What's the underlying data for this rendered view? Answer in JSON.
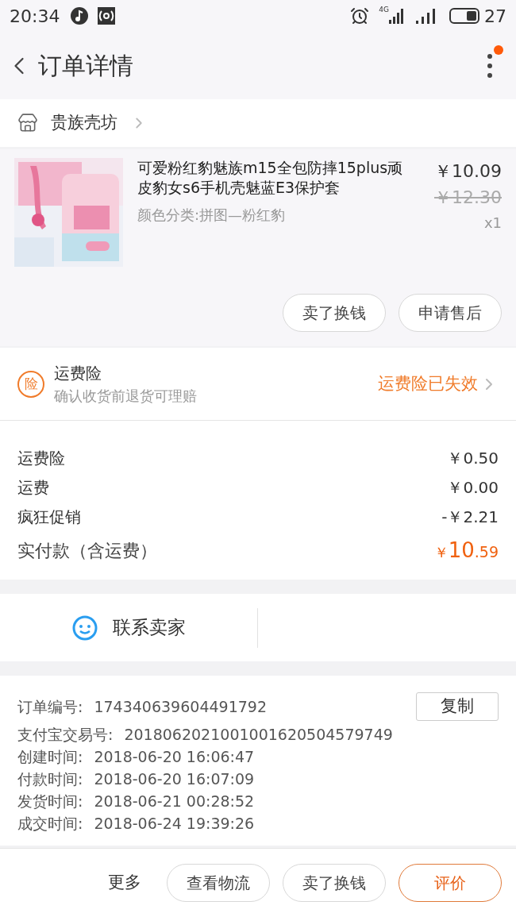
{
  "status_bar": {
    "time": "20:34",
    "network": "4G",
    "battery": "27"
  },
  "header": {
    "title": "订单详情",
    "notification_dot": true
  },
  "shop": {
    "name": "贵族壳坊"
  },
  "product": {
    "kind": "picture",
    "title": "可爱粉红豹魅族m15全包防摔15plus顽皮豹女s6手机壳魅蓝E3保护套",
    "variant": "颜色分类:拼图—粉红豹",
    "price": "￥10.09",
    "original_price": "￥12.30",
    "quantity": "x1",
    "actions": [
      "卖了换钱",
      "申请售后"
    ]
  },
  "insurance": {
    "title": "运费险",
    "subtitle": "确认收货前退货可理赔",
    "badge": "险",
    "status": "运费险已失效"
  },
  "fees": [
    {
      "label": "运费险",
      "value": "￥0.50"
    },
    {
      "label": "运费",
      "value": "￥0.00"
    },
    {
      "label": "疯狂促销",
      "value": "-￥2.21"
    }
  ],
  "total": {
    "label": "实付款（含运费）",
    "currency": "￥",
    "integer": "10",
    "decimal": ".59"
  },
  "contact": {
    "label": "联系卖家"
  },
  "order_info": {
    "copy_button": "复制",
    "rows": [
      {
        "label": "订单编号:",
        "value": "174340639604491792"
      },
      {
        "label": "支付宝交易号:",
        "value": "2018062021001001620504579749"
      },
      {
        "label": "创建时间:",
        "value": "2018-06-20 16:06:47"
      },
      {
        "label": "付款时间:",
        "value": "2018-06-20 16:07:09"
      },
      {
        "label": "发货时间:",
        "value": "2018-06-21 00:28:52"
      },
      {
        "label": "成交时间:",
        "value": "2018-06-24 19:39:26"
      }
    ]
  },
  "bottom_bar": {
    "more": "更多",
    "buttons": [
      {
        "label": "查看物流",
        "primary": false
      },
      {
        "label": "卖了换钱",
        "primary": false
      },
      {
        "label": "评价",
        "primary": true
      }
    ]
  }
}
